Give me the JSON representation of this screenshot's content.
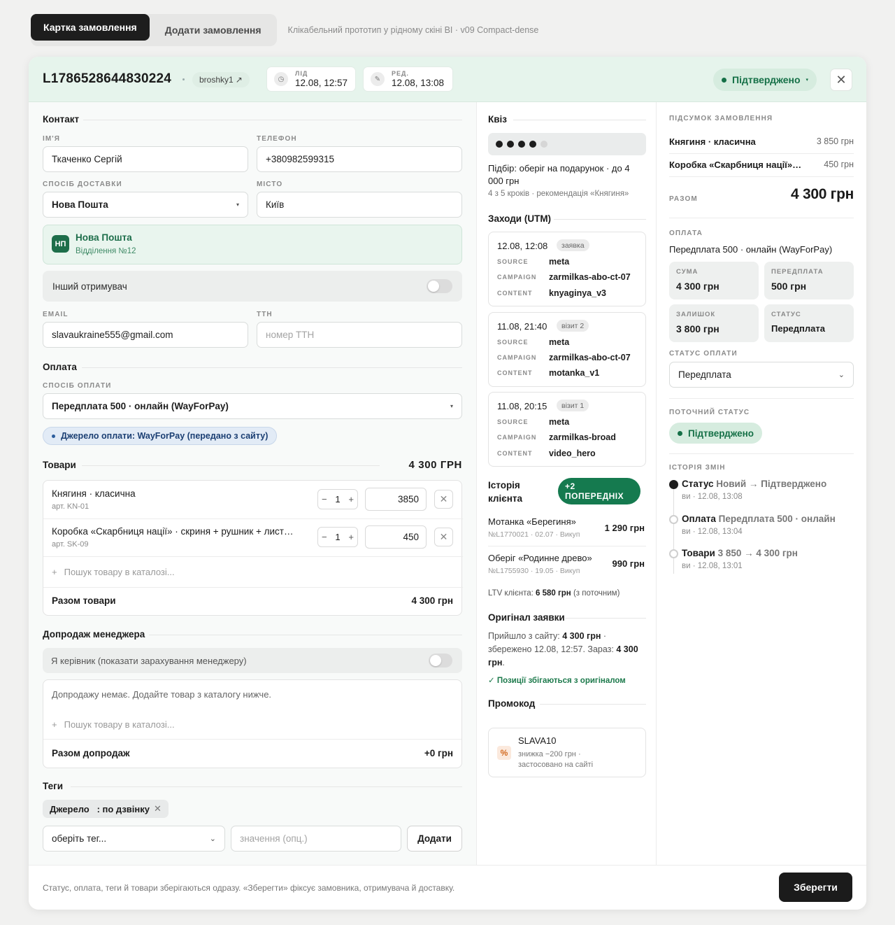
{
  "topbar": {
    "tabs": [
      "Картка замовлення",
      "Додати замовлення"
    ],
    "prototype_note": "Клікабельний прототип у рідному скіні BI · v09 Compact-dense"
  },
  "header": {
    "order_id": "L1786528644830224",
    "shop": "broshky1",
    "lead": {
      "label": "ЛІД",
      "value": "12.08, 12:57"
    },
    "edited": {
      "label": "РЕД.",
      "value": "12.08, 13:08"
    },
    "status": "Підтверджено"
  },
  "contact": {
    "title": "Контакт",
    "name_label": "ІМ'Я",
    "name": "Ткаченко Сергій",
    "phone_label": "ТЕЛЕФОН",
    "phone": "+380982599315",
    "delivery_label": "СПОСІБ ДОСТАВКИ",
    "delivery": "Нова Пошта",
    "city_label": "МІСТО",
    "city": "Київ",
    "np": {
      "logo": "НП",
      "title": "Нова Пошта",
      "branch": "Відділення №12"
    },
    "other_recipient": "Інший отримувач",
    "email_label": "EMAIL",
    "email": "slavaukraine555@gmail.com",
    "ttn_label": "ТТН",
    "ttn_placeholder": "номер ТТН"
  },
  "payment": {
    "title": "Оплата",
    "method_label": "СПОСІБ ОПЛАТИ",
    "method": "Передплата 500 · онлайн (WayForPay)",
    "source_chip": "Джерело оплати: WayForPay (передано з сайту)"
  },
  "goods": {
    "title": "Товари",
    "total_header": "4 300 ГРН",
    "items": [
      {
        "name": "Княгиня · класична",
        "sku": "арт. KN-01",
        "qty": "1",
        "price": "3850"
      },
      {
        "name": "Коробка «Скарбниця нації» · скриня + рушник + лист…",
        "sku": "арт. SK-09",
        "qty": "1",
        "price": "450"
      }
    ],
    "search_placeholder": "Пошук товару в каталозі...",
    "total_label": "Разом товари",
    "total_value": "4 300 грн"
  },
  "upsell": {
    "title": "Допродаж менеджера",
    "manager_toggle": "Я керівник (показати зарахування менеджеру)",
    "empty_text": "Допродажу немає. Додайте товар з каталогу нижче.",
    "search_placeholder": "Пошук товару в каталозі...",
    "total_label": "Разом допродаж",
    "total_value": "+0 грн"
  },
  "tags": {
    "title": "Теги",
    "chip": "Джерело   : по дзвінку",
    "select_placeholder": "оберіть тег...",
    "value_placeholder": "значення (опц.)",
    "add_label": "Додати"
  },
  "quiz": {
    "title": "Квіз",
    "steps_done": 4,
    "steps_total": 5,
    "summary": "Підбір: оберіг на подарунок · до 4 000 грн",
    "detail": "4 з 5 кроків · рекомендація «Княгиня»"
  },
  "utm": {
    "title": "Заходи (UTM)",
    "keys": [
      "SOURCE",
      "CAMPAIGN",
      "CONTENT"
    ],
    "visits": [
      {
        "datetime": "12.08, 12:08",
        "badge": "заявка",
        "source": "meta",
        "campaign": "zarmilkas-abo-ct-07",
        "content": "knyaginya_v3"
      },
      {
        "datetime": "11.08, 21:40",
        "badge": "візит 2",
        "source": "meta",
        "campaign": "zarmilkas-abo-ct-07",
        "content": "motanka_v1"
      },
      {
        "datetime": "11.08, 20:15",
        "badge": "візит 1",
        "source": "meta",
        "campaign": "zarmilkas-broad",
        "content": "video_hero"
      }
    ]
  },
  "client_history": {
    "title": "Історія клієнта",
    "badge": "+2 ПОПЕРЕДНІХ",
    "orders": [
      {
        "name": "Мотанка «Берегиня»",
        "meta": "№L1770021 · 02.07 · Викуп",
        "sum": "1 290 грн"
      },
      {
        "name": "Оберіг «Родинне древо»",
        "meta": "№L1755930 · 19.05 · Викуп",
        "sum": "990 грн"
      }
    ],
    "ltv_prefix": "LTV клієнта:",
    "ltv_value": "6 580 грн",
    "ltv_suffix": "(з поточним)"
  },
  "original": {
    "title": "Оригінал заявки",
    "t1": "Прийшло з сайту:",
    "v1": "4 300 грн",
    "t2": "· збережено 12.08, 12:57. Зараз:",
    "v2": "4 300 грн",
    "t3": ".",
    "match": "✓ Позиції збігаються з оригіналом"
  },
  "promo": {
    "title": "Промокод",
    "icon": "%",
    "code": "SLAVA10",
    "desc": "знижка −200 грн · застосовано на сайті"
  },
  "summary": {
    "title": "ПІДСУМОК ЗАМОВЛЕННЯ",
    "lines": [
      {
        "name": "Княгиня · класична",
        "sum": "3 850 грн"
      },
      {
        "name": "Коробка «Скарбниця нації» · скриня + рушник + лист",
        "sum": "450 грн"
      }
    ],
    "total_label": "РАЗОМ",
    "total_value": "4 300 грн",
    "pay_label": "ОПЛАТА",
    "pay_method": "Передплата 500 · онлайн (WayForPay)",
    "boxes": [
      {
        "label": "СУМА",
        "value": "4 300 грн"
      },
      {
        "label": "ПЕРЕДПЛАТА",
        "value": "500 грн"
      },
      {
        "label": "ЗАЛИШОК",
        "value": "3 800 грн"
      },
      {
        "label": "СТАТУС",
        "value": "Передплата"
      }
    ],
    "pay_status_label": "СТАТУС ОПЛАТИ",
    "pay_status": "Передплата",
    "current_status_label": "ПОТОЧНИЙ СТАТУС",
    "current_status": "Підтверджено",
    "history_label": "ІСТОРІЯ ЗМІН",
    "history": [
      {
        "kind": "Статус",
        "detail": "Новий → Підтверджено",
        "when": "ви · 12.08, 13:08"
      },
      {
        "kind": "Оплата",
        "detail": "Передплата 500 · онлайн",
        "when": "ви · 12.08, 13:04"
      },
      {
        "kind": "Товари",
        "detail": "3 850 → 4 300 грн",
        "when": "ви · 12.08, 13:01"
      }
    ]
  },
  "footer": {
    "note": "Статус, оплата, теги й товари зберігаються одразу. «Зберегти» фіксує замовника, отримувача й доставку.",
    "save_label": "Зберегти"
  },
  "colors": {
    "accent": "#157047",
    "header_bg": "#e6f4ec",
    "dark": "#1b1b1b"
  }
}
